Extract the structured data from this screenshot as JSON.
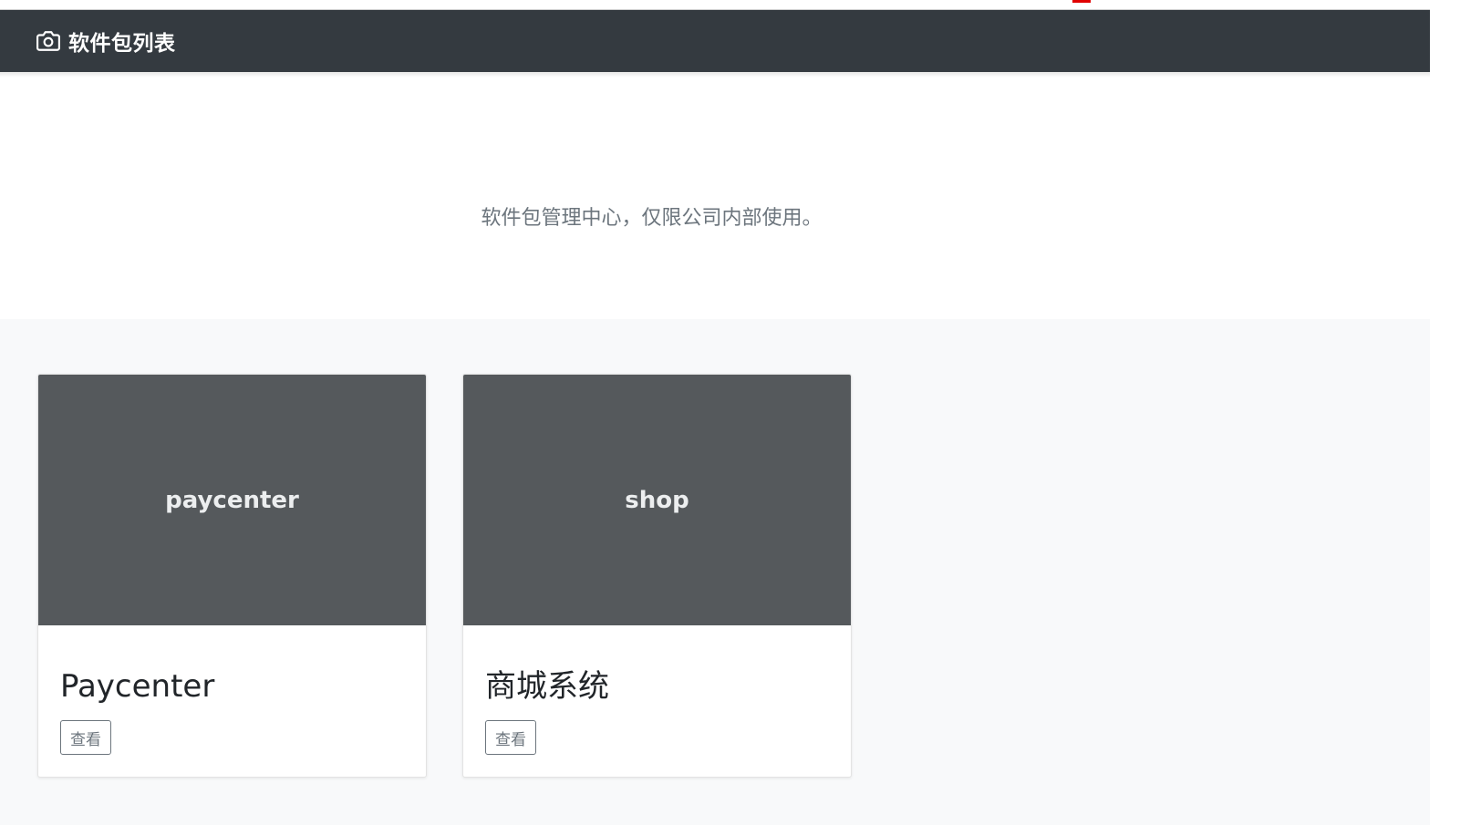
{
  "navbar": {
    "brand_icon": "camera-icon",
    "brand_title": "软件包列表",
    "background": "#343a40"
  },
  "jumbotron": {
    "lead": "软件包管理中心，仅限公司内部使用。"
  },
  "cards": [
    {
      "thumbnail_text": "paycenter",
      "title": "Paycenter",
      "button_label": "查看"
    },
    {
      "thumbnail_text": "shop",
      "title": "商城系统",
      "button_label": "查看"
    }
  ],
  "colors": {
    "thumbnail_bg": "#55595c",
    "album_bg": "#f8f9fa",
    "button_border": "#6c757d"
  }
}
